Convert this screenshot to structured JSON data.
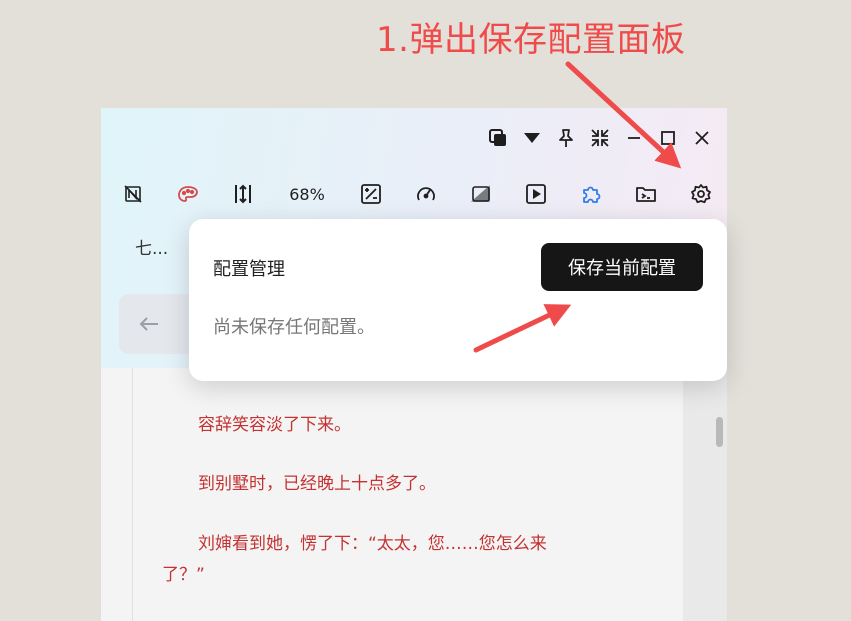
{
  "annotation": {
    "title": "1.弹出保存配置面板",
    "color": "#f04b4b"
  },
  "window": {
    "title_controls": [
      {
        "name": "copy-window-icon"
      },
      {
        "name": "dropdown-triangle-icon"
      },
      {
        "name": "pin-icon"
      },
      {
        "name": "shrink-icon"
      },
      {
        "name": "minimize-icon"
      },
      {
        "name": "maximize-icon"
      },
      {
        "name": "close-icon"
      }
    ],
    "toolbar": {
      "zoom_level": "68%",
      "items": [
        {
          "name": "no-image-icon"
        },
        {
          "name": "theme-palette-icon",
          "color": "#d84a4a"
        },
        {
          "name": "line-spacing-icon"
        },
        {
          "name": "zoom-level"
        },
        {
          "name": "brightness-icon"
        },
        {
          "name": "speedometer-icon"
        },
        {
          "name": "contrast-icon"
        },
        {
          "name": "play-icon"
        },
        {
          "name": "extension-puzzle-icon",
          "color": "#2f7ee8"
        },
        {
          "name": "terminal-icon"
        },
        {
          "name": "settings-gear-icon"
        }
      ]
    },
    "tab_title": "七...",
    "back_icon": "arrow-left-icon"
  },
  "popup": {
    "title": "配置管理",
    "save_button_label": "保存当前配置",
    "empty_message": "尚未保存任何配置。"
  },
  "reader": {
    "text_color": "#c43232",
    "paragraphs": [
      "容辞笑容淡了下来。",
      "到别墅时，已经晚上十点多了。",
      "刘婶看到她，愣了下：“太太，您……您怎么来了？”"
    ]
  }
}
